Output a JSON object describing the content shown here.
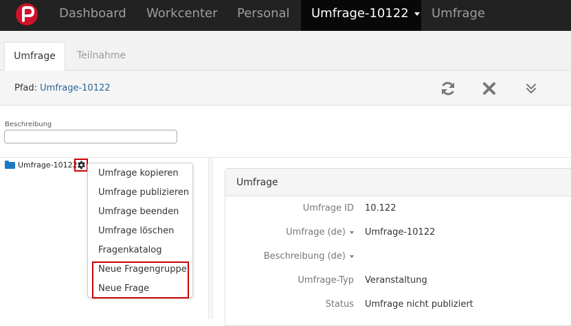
{
  "navbar": {
    "items": [
      {
        "label": "Dashboard"
      },
      {
        "label": "Workcenter"
      },
      {
        "label": "Personal"
      },
      {
        "label": "Umfrage-10122"
      },
      {
        "label": "Umfrage"
      }
    ],
    "brand_color": "#d0112b"
  },
  "tabs": [
    {
      "label": "Umfrage",
      "active": true
    },
    {
      "label": "Teilnahme",
      "active": false
    }
  ],
  "pathbar": {
    "label": "Pfad:",
    "path": "Umfrage-10122",
    "icons": [
      "refresh-icon",
      "close-icon",
      "double-chevron-down-icon"
    ]
  },
  "filter": {
    "label": "Beschreibung",
    "value": ""
  },
  "tree": {
    "root_label": "Umfrage-10122"
  },
  "context_menu": {
    "items": [
      {
        "label": "Umfrage kopieren"
      },
      {
        "label": "Umfrage publizieren"
      },
      {
        "label": "Umfrage beenden"
      },
      {
        "label": "Umfrage löschen"
      },
      {
        "label": "Fragenkatalog"
      },
      {
        "label": "Neue Fragengruppe"
      },
      {
        "label": "Neue Frage"
      }
    ],
    "highlight_color": "#cc0000"
  },
  "detail": {
    "title": "Umfrage",
    "rows": [
      {
        "label": "Umfrage ID",
        "value": "10.122"
      },
      {
        "label": "Umfrage (de)",
        "value": "Umfrage-10122"
      },
      {
        "label": "Beschreibung (de)",
        "value": ""
      },
      {
        "label": "Umfrage-Typ",
        "value": "Veranstaltung"
      },
      {
        "label": "Status",
        "value": "Umfrage nicht publiziert"
      }
    ]
  }
}
